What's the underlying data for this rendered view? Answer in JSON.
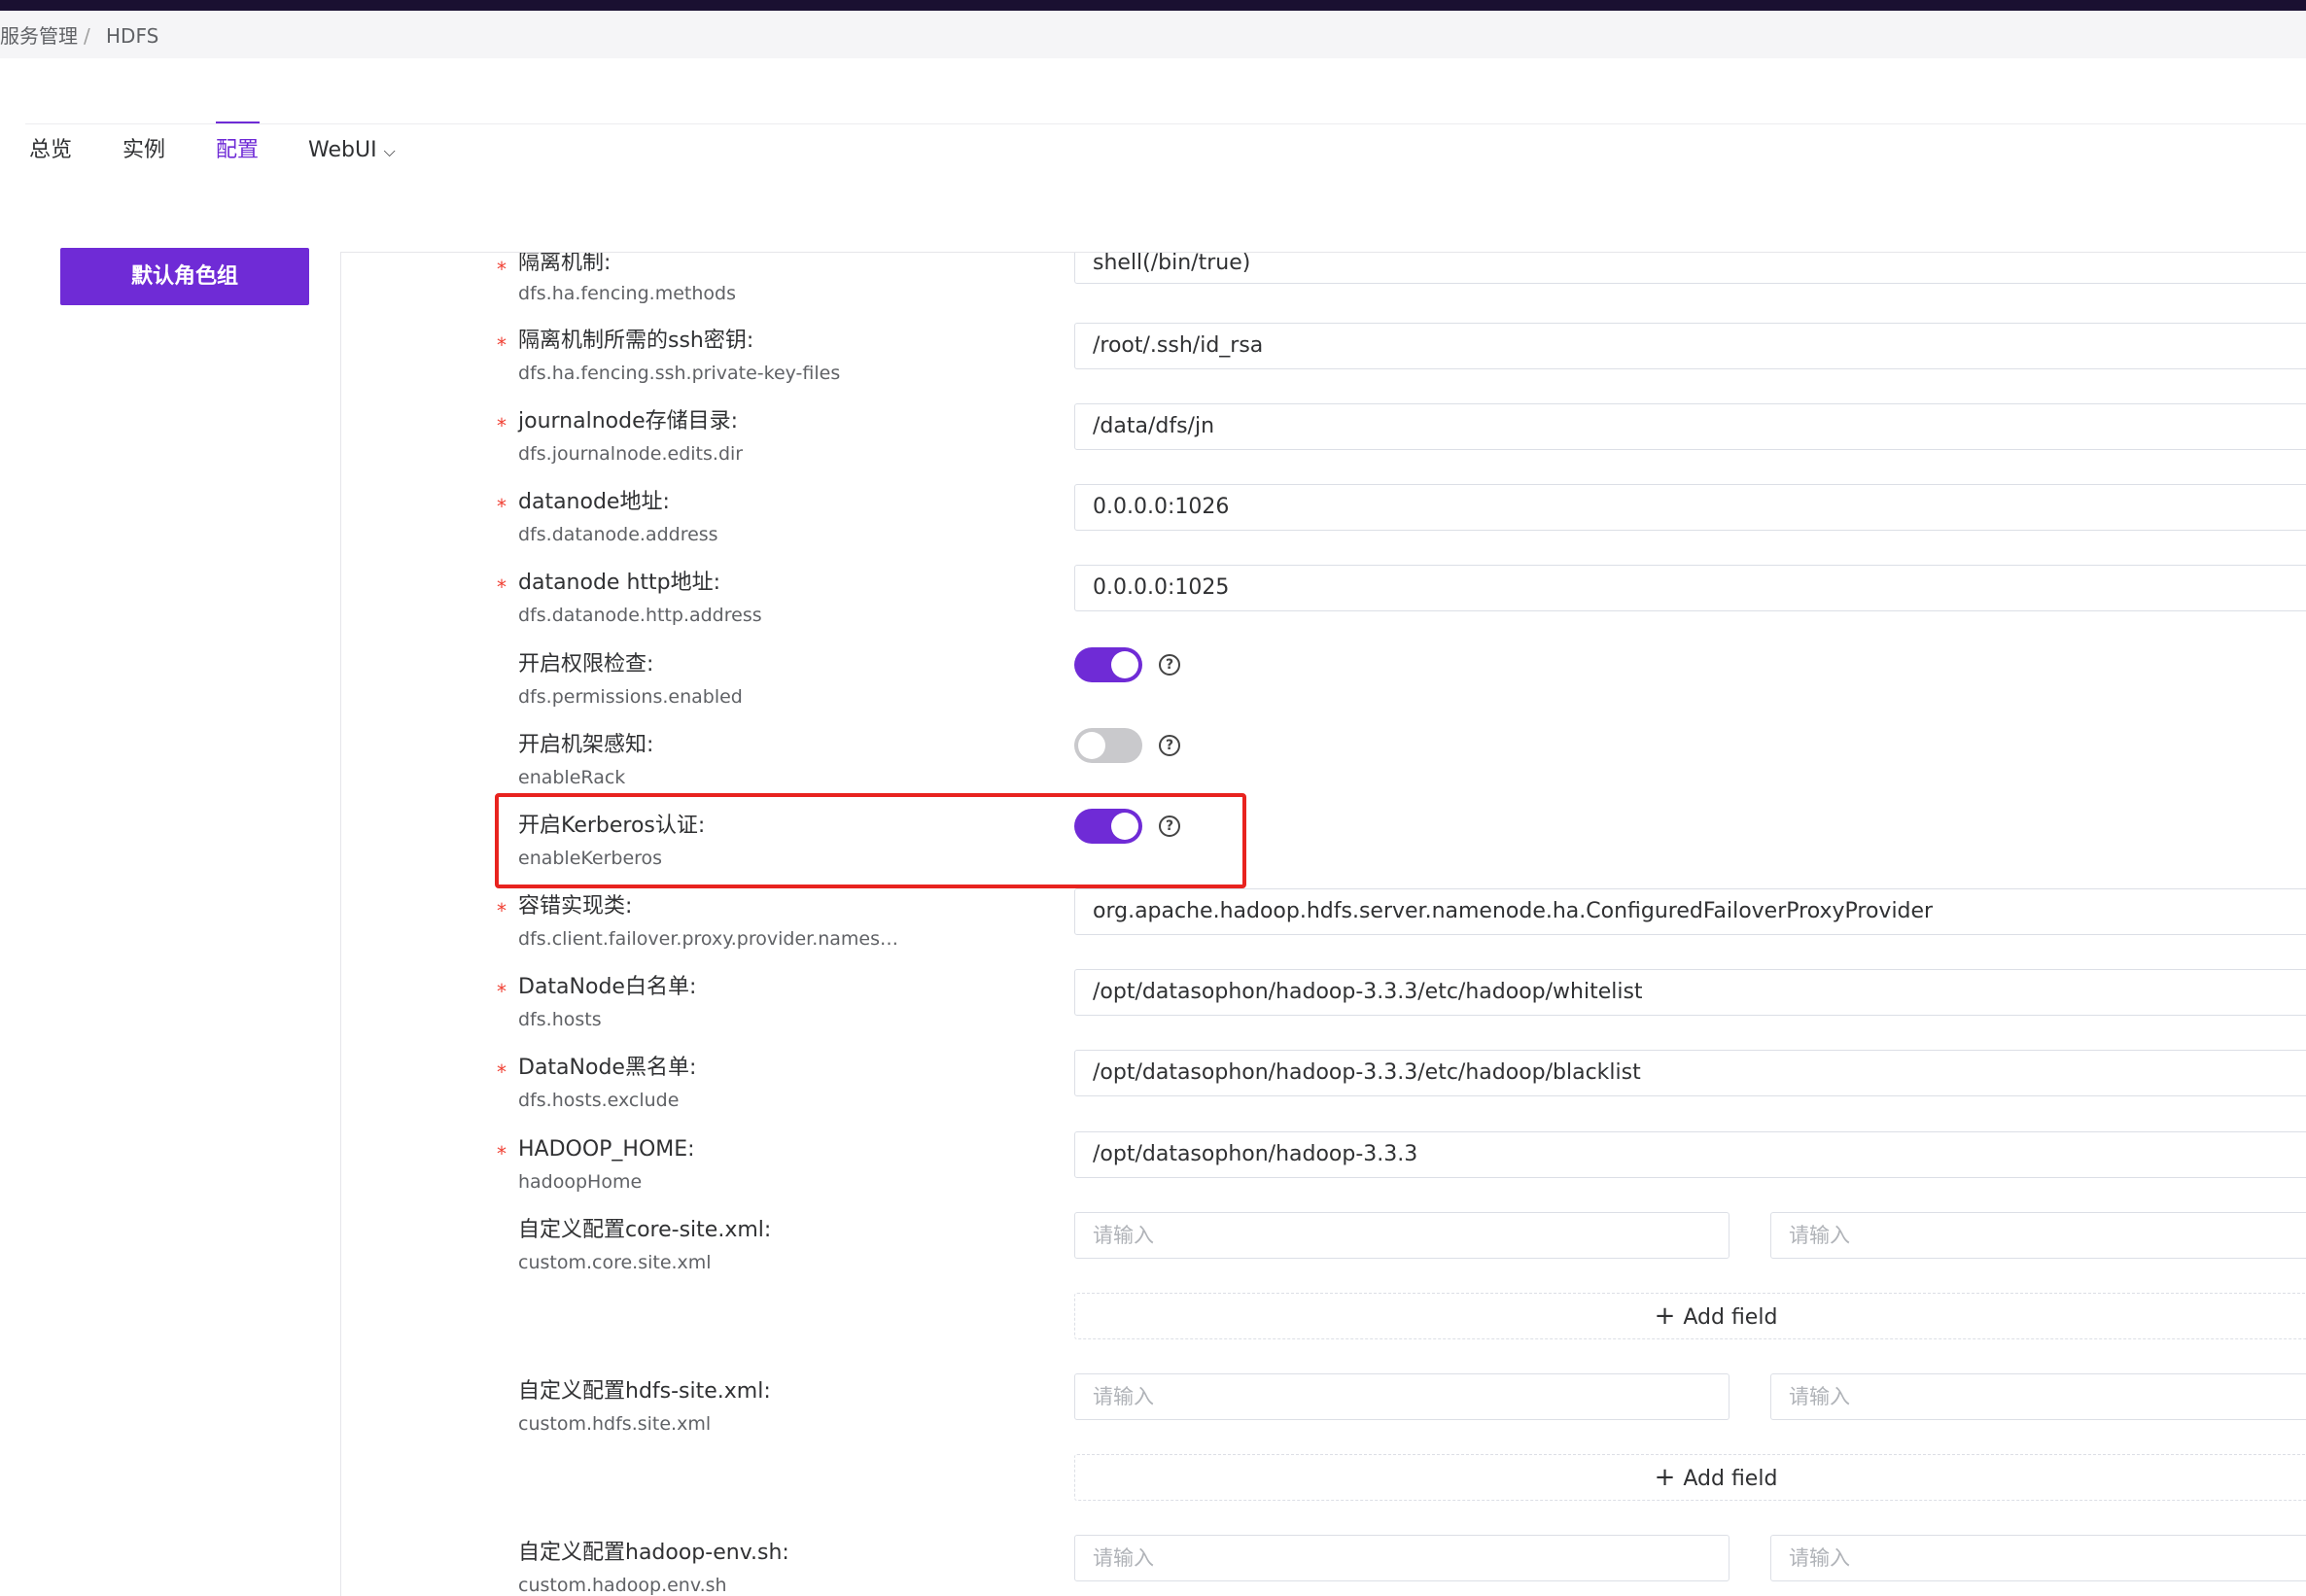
{
  "breadcrumb": {
    "parent": "服务管理",
    "separator": "/",
    "current": "HDFS"
  },
  "tabs": [
    {
      "label": "总览"
    },
    {
      "label": "实例"
    },
    {
      "label": "配置"
    },
    {
      "label": "WebUI",
      "caret": "⌵"
    }
  ],
  "active_tab": "配置",
  "role_group_button": "默认角色组",
  "config": {
    "fencing": {
      "label": "隔离机制:",
      "key": "dfs.ha.fencing.methods",
      "value": "shell(/bin/true)",
      "required": true
    },
    "ssh_key": {
      "label": "隔离机制所需的ssh密钥:",
      "key": "dfs.ha.fencing.ssh.private-key-files",
      "value": "/root/.ssh/id_rsa",
      "required": true
    },
    "journal": {
      "label": "journalnode存储目录:",
      "key": "dfs.journalnode.edits.dir",
      "value": "/data/dfs/jn",
      "required": true
    },
    "dn_addr": {
      "label": "datanode地址:",
      "key": "dfs.datanode.address",
      "value": "0.0.0.0:1026",
      "required": true
    },
    "dn_http": {
      "label": "datanode http地址:",
      "key": "dfs.datanode.http.address",
      "value": "0.0.0.0:1025",
      "required": true
    },
    "perm": {
      "label": "开启权限检查:",
      "key": "dfs.permissions.enabled",
      "enabled": true
    },
    "rack": {
      "label": "开启机架感知:",
      "key": "enableRack",
      "enabled": false
    },
    "kerberos": {
      "label": "开启Kerberos认证:",
      "key": "enableKerberos",
      "enabled": true
    },
    "failover": {
      "label": "容错实现类:",
      "key": "dfs.client.failover.proxy.provider.nameservi…",
      "value": "org.apache.hadoop.hdfs.server.namenode.ha.ConfiguredFailoverProxyProvider",
      "required": true
    },
    "whitelist": {
      "label": "DataNode白名单:",
      "key": "dfs.hosts",
      "value": "/opt/datasophon/hadoop-3.3.3/etc/hadoop/whitelist",
      "required": true
    },
    "blacklist": {
      "label": "DataNode黑名单:",
      "key": "dfs.hosts.exclude",
      "value": "/opt/datasophon/hadoop-3.3.3/etc/hadoop/blacklist",
      "required": true
    },
    "hadoop_home": {
      "label": "HADOOP_HOME:",
      "key": "hadoopHome",
      "value": "/opt/datasophon/hadoop-3.3.3",
      "required": true
    },
    "custom_core": {
      "label": "自定义配置core-site.xml:",
      "key": "custom.core.site.xml"
    },
    "custom_hdfs": {
      "label": "自定义配置hdfs-site.xml:",
      "key": "custom.hdfs.site.xml"
    },
    "custom_env": {
      "label": "自定义配置hadoop-env.sh:",
      "key": "custom.hadoop.env.sh"
    }
  },
  "required_mark": "*",
  "placeholder": "请输入",
  "add_field_label": "Add field",
  "add_icon": "+",
  "help_icon": "?",
  "colors": {
    "accent": "#6f2bd6",
    "highlight": "#e8231f",
    "required": "#f04134"
  }
}
